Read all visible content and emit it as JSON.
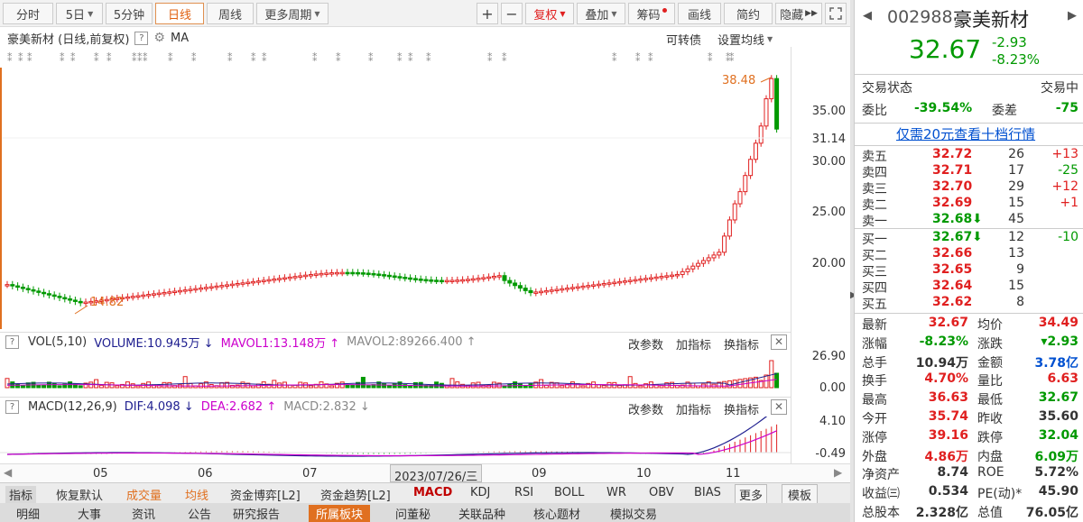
{
  "toolbar": {
    "period_buttons": [
      "分时",
      "5日",
      "5分钟",
      "日线",
      "周线",
      "更多周期"
    ],
    "right_buttons": [
      "复权",
      "叠加",
      "筹码",
      "画线",
      "简约",
      "隐藏"
    ],
    "plus": "+",
    "minus": "−"
  },
  "chart_info": {
    "title": "豪美新材 (日线,前复权)",
    "indicator": "MA",
    "convertible": "可转债",
    "set_ma": "设置均线"
  },
  "price_axis": [
    "35.00",
    "30.00",
    "25.00",
    "20.00"
  ],
  "current_price_label": "31.14",
  "annotations": {
    "high": "38.48",
    "low": "14.82"
  },
  "vol_panel": {
    "name": "VOL(5,10)",
    "volume": "VOLUME:10.945万",
    "mavol1": "MAVOL1:13.148万",
    "mavol2": "MAVOL2:89266.400",
    "axis": [
      "26.90",
      "0.00"
    ]
  },
  "macd_panel": {
    "name": "MACD(12,26,9)",
    "dif": "DIF:4.098",
    "dea": "DEA:2.682",
    "macd": "MACD:2.832",
    "axis": [
      "4.10",
      "-0.49"
    ]
  },
  "panel_actions": [
    "改参数",
    "加指标",
    "换指标"
  ],
  "x_axis": {
    "labels": [
      "05",
      "06",
      "07",
      "09",
      "10",
      "11"
    ],
    "cursor_date": "2023/07/26/三"
  },
  "tabs_row1": [
    "指标",
    "恢复默认",
    "成交量",
    "均线",
    "资金博弈[L2]",
    "资金趋势[L2]",
    "MACD",
    "KDJ",
    "RSI",
    "BOLL",
    "WR",
    "OBV",
    "BIAS",
    "更多",
    "模板"
  ],
  "tabs_row2": [
    "明细",
    "大事",
    "资讯",
    "公告",
    "研究报告",
    "所属板块",
    "问董秘",
    "关联品种",
    "核心题材",
    "模拟交易"
  ],
  "quote": {
    "code": "002988",
    "name": "豪美新材",
    "price": "32.67",
    "change": "-2.93",
    "change_pct": "-8.23%",
    "status_label": "交易状态",
    "status_value": "交易中",
    "wb_label": "委比",
    "wb_value": "-39.54%",
    "wc_label": "委差",
    "wc_value": "-75",
    "link": "仅需20元查看十档行情",
    "asks": [
      {
        "label": "卖五",
        "price": "32.72",
        "vol": "26",
        "chg": "+13"
      },
      {
        "label": "卖四",
        "price": "32.71",
        "vol": "17",
        "chg": "-25"
      },
      {
        "label": "卖三",
        "price": "32.70",
        "vol": "29",
        "chg": "+12"
      },
      {
        "label": "卖二",
        "price": "32.69",
        "vol": "15",
        "chg": "+1"
      },
      {
        "label": "卖一",
        "price": "32.68",
        "vol": "45",
        "chg": ""
      }
    ],
    "bids": [
      {
        "label": "买一",
        "price": "32.67",
        "vol": "12",
        "chg": "-10"
      },
      {
        "label": "买二",
        "price": "32.66",
        "vol": "13",
        "chg": ""
      },
      {
        "label": "买三",
        "price": "32.65",
        "vol": "9",
        "chg": ""
      },
      {
        "label": "买四",
        "price": "32.64",
        "vol": "15",
        "chg": ""
      },
      {
        "label": "买五",
        "price": "32.62",
        "vol": "8",
        "chg": ""
      }
    ],
    "stats": [
      {
        "l1": "最新",
        "v1": "32.67",
        "l2": "均价",
        "v2": "34.49"
      },
      {
        "l1": "涨幅",
        "v1": "-8.23%",
        "l2": "涨跌",
        "v2": "▾2.93"
      },
      {
        "l1": "总手",
        "v1": "10.94万",
        "l2": "金额",
        "v2": "3.78亿"
      },
      {
        "l1": "换手",
        "v1": "4.70%",
        "l2": "量比",
        "v2": "6.63"
      },
      {
        "l1": "最高",
        "v1": "36.63",
        "l2": "最低",
        "v2": "32.67"
      },
      {
        "l1": "今开",
        "v1": "35.74",
        "l2": "昨收",
        "v2": "35.60"
      },
      {
        "l1": "涨停",
        "v1": "39.16",
        "l2": "跌停",
        "v2": "32.04"
      },
      {
        "l1": "外盘",
        "v1": "4.86万",
        "l2": "内盘",
        "v2": "6.09万"
      },
      {
        "l1": "净资产",
        "v1": "8.74",
        "l2": "ROE",
        "v2": "5.72%"
      },
      {
        "l1": "收益㈢",
        "v1": "0.534",
        "l2": "PE(动)*",
        "v2": "45.90"
      },
      {
        "l1": "总股本",
        "v1": "2.328亿",
        "l2": "总值",
        "v2": "76.05亿"
      }
    ]
  },
  "colors": {
    "up": "#e02020",
    "down": "#009900",
    "accent": "#e07020",
    "link": "#0050d0"
  }
}
